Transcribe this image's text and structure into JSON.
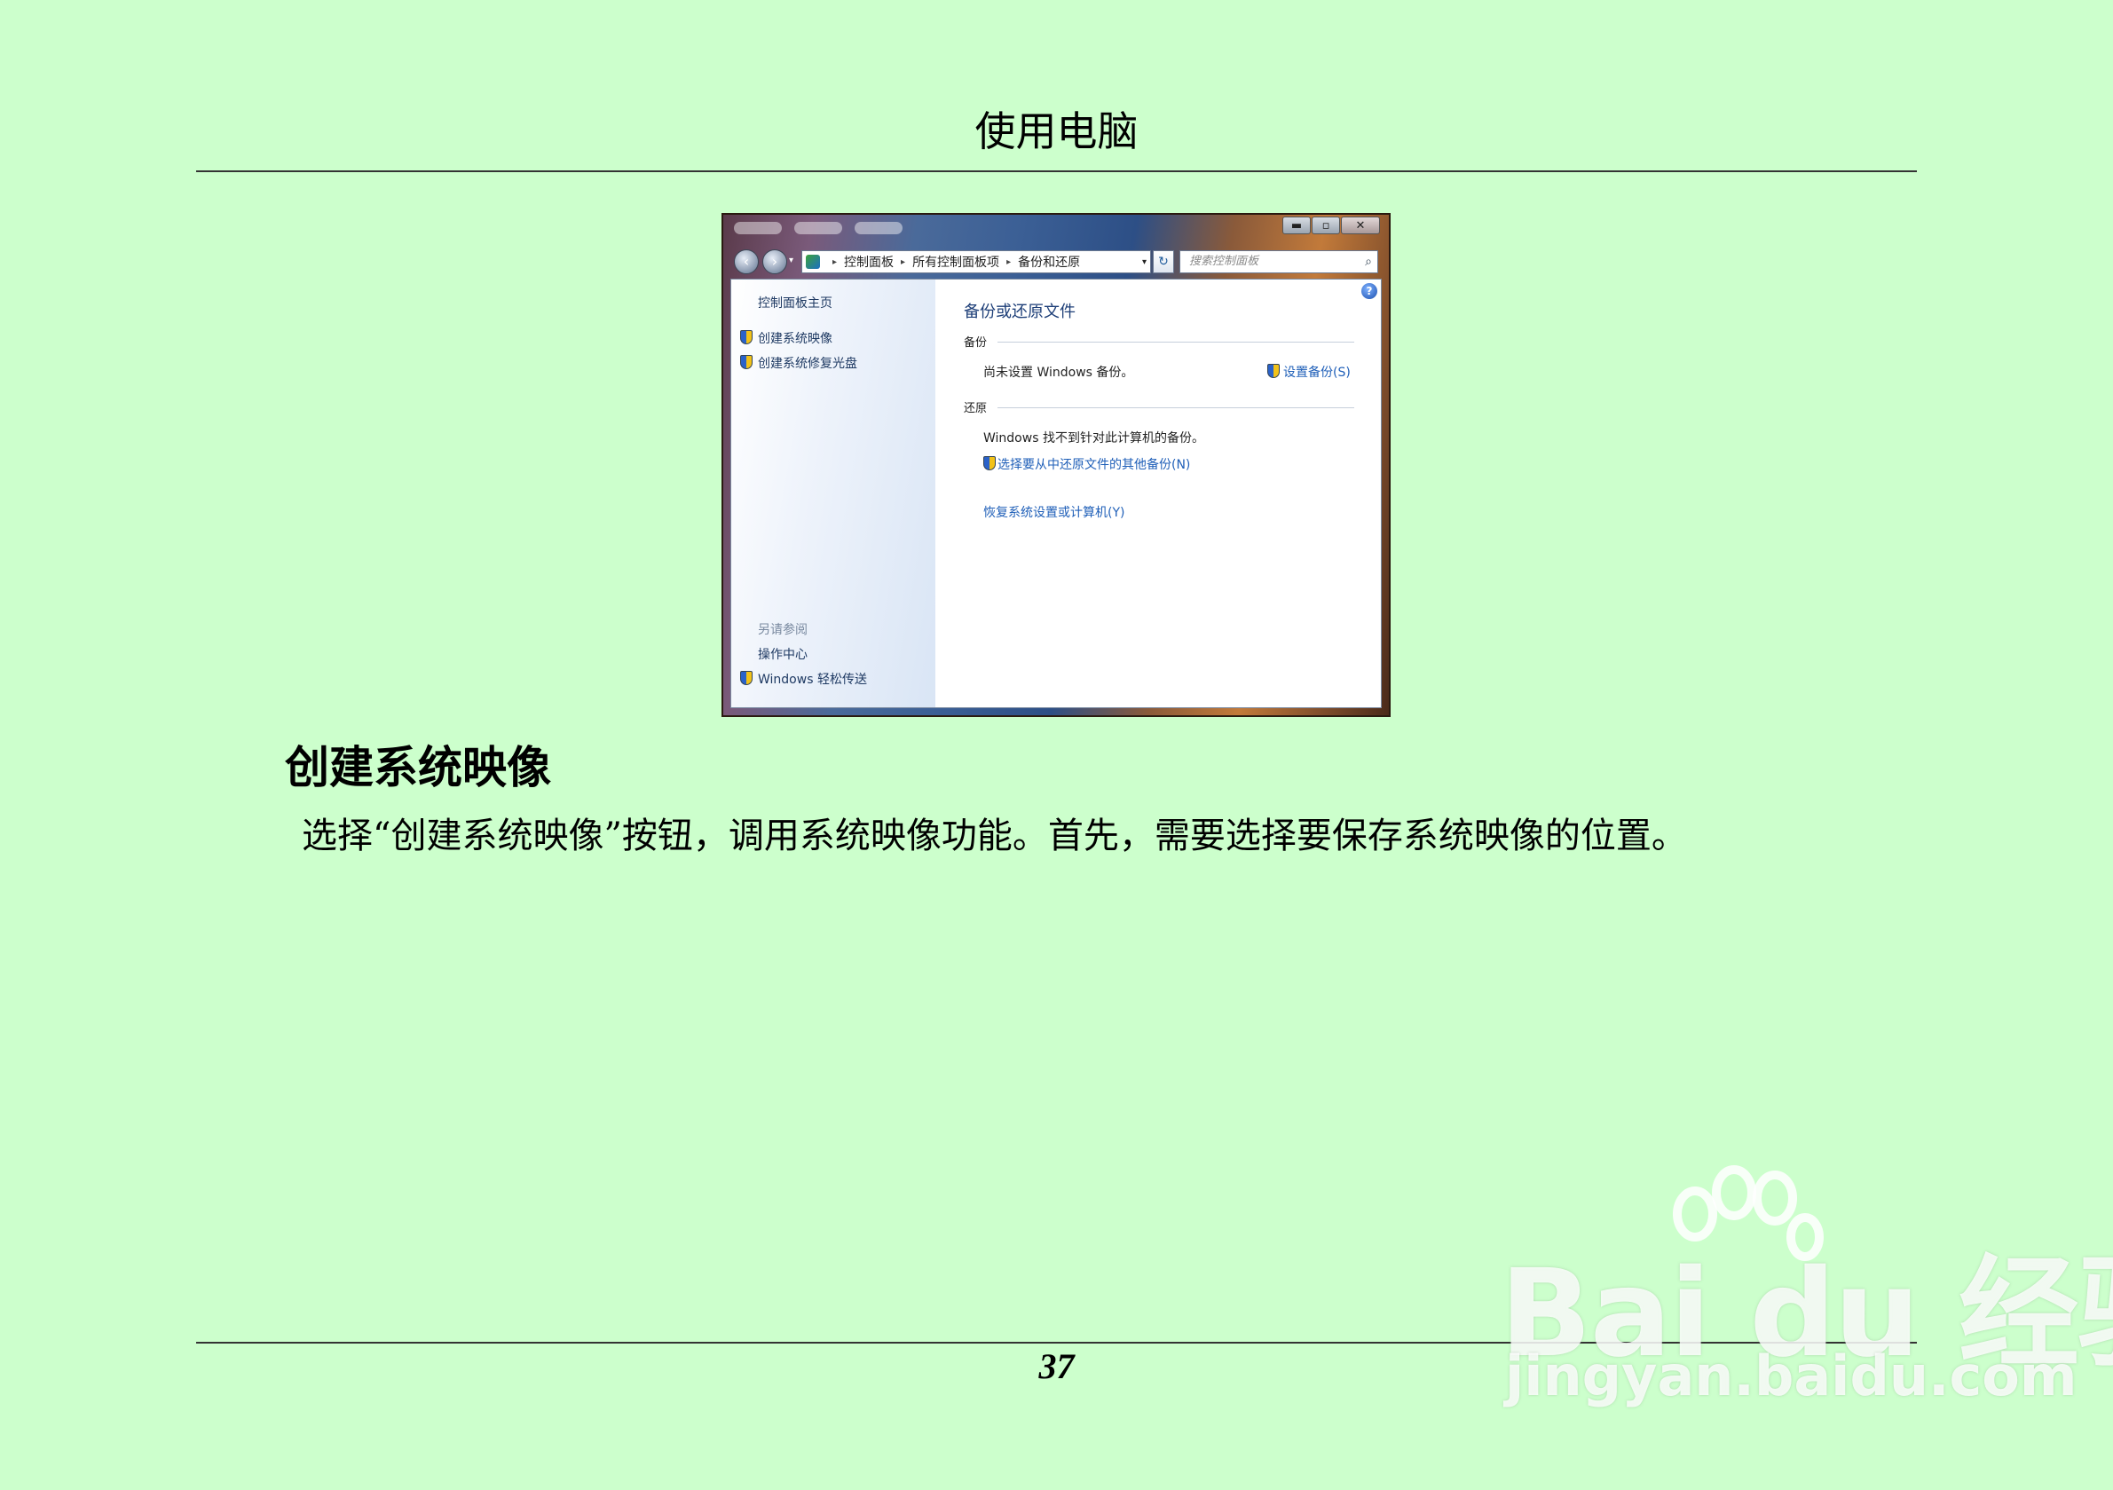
{
  "page": {
    "header": "使用电脑",
    "section_heading": "创建系统映像",
    "paragraph": "选择“创建系统映像”按钮，调用系统映像功能。首先，需要选择要保存系统映像的位置。",
    "page_number": "37"
  },
  "screenshot": {
    "window_buttons": [
      "▬",
      "▫",
      "✕"
    ],
    "address_bar": {
      "crumbs": [
        "控制面板",
        "所有控制面板项",
        "备份和还原"
      ]
    },
    "search_placeholder": "搜索控制面板",
    "left_pane": {
      "home": "控制面板主页",
      "tasks": [
        "创建系统映像",
        "创建系统修复光盘"
      ],
      "see_also_title": "另请参阅",
      "see_also": [
        "操作中心",
        "Windows 轻松传送"
      ]
    },
    "main": {
      "title": "备份或还原文件",
      "backup_label": "备份",
      "backup_status": "尚未设置 Windows 备份。",
      "setup_link": "设置备份(S)",
      "restore_label": "还原",
      "restore_status": "Windows 找不到针对此计算机的备份。",
      "other_backup_link": "选择要从中还原文件的其他备份(N)",
      "recover_link": "恢复系统设置或计算机(Y)"
    }
  },
  "watermark": {
    "brand": "Bai du 经验",
    "url": "jingyan.baidu.com"
  },
  "colors": {
    "page_background": "#ccffcc",
    "link": "#1f5fb8"
  }
}
